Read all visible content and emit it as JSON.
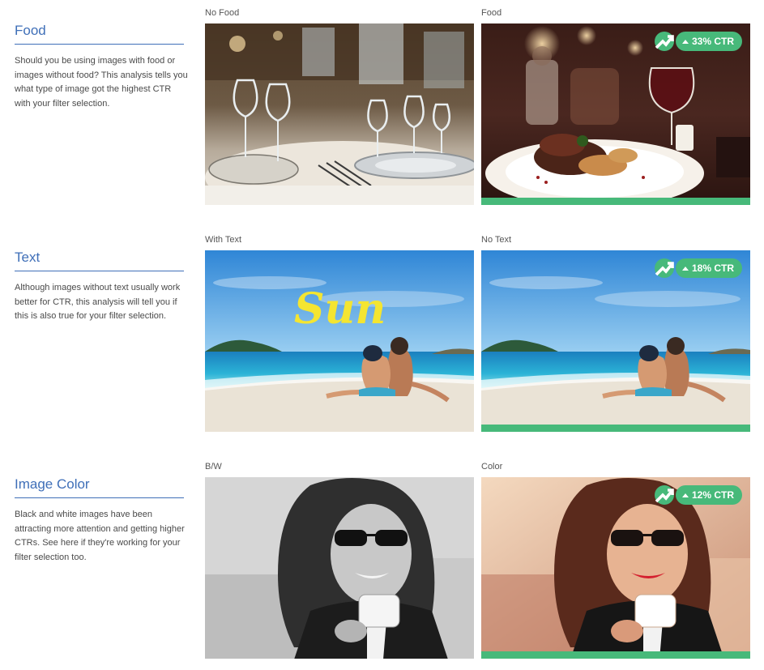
{
  "sections": [
    {
      "title": "Food",
      "description": "Should you be using images with food or images without food? This analysis tells you what type of image got the highest CTR with your filter selection.",
      "left_label": "No Food",
      "right_label": "Food",
      "badge": "33% CTR",
      "badge_icon": "trending-up-icon",
      "winner": "right"
    },
    {
      "title": "Text",
      "description": "Although images without text usually work better for CTR, this analysis will tell you if this is also true for your filter selection.",
      "left_label": "With Text",
      "right_label": "No Text",
      "overlay_text": "Sun",
      "badge": "18% CTR",
      "badge_icon": "trending-up-icon",
      "winner": "right"
    },
    {
      "title": "Image Color",
      "description": "Black and white images have been attracting more attention and getting higher CTRs. See here if they're working for your filter selection too.",
      "left_label": "B/W",
      "right_label": "Color",
      "badge": "12% CTR",
      "badge_icon": "trending-up-icon",
      "winner": "right"
    }
  ],
  "colors": {
    "title_blue": "#3f6fb8",
    "winner_green": "#47b97a",
    "text_gray": "#4a4a4a"
  }
}
